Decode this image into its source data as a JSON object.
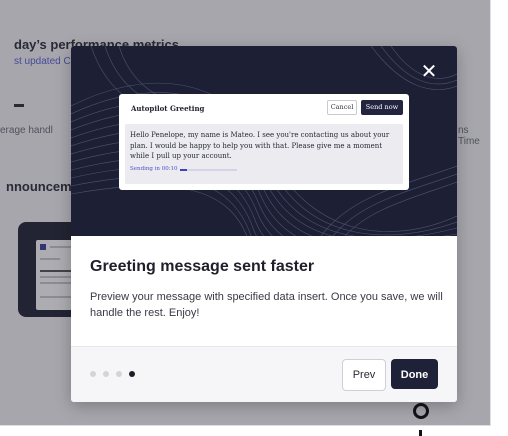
{
  "background": {
    "title": "day’s performance metrics",
    "updated": "st updated C",
    "left_label": "erage handl",
    "right_label": "ns Time",
    "announcements": "nnounceme"
  },
  "modal": {
    "close_icon": "close-icon",
    "preview": {
      "title": "Autopilot Greeting",
      "cancel": "Cancel",
      "send": "Send now",
      "message": "Hello Penelope, my name is Mateo. I see you're contacting us about your plan. I would be happy to help you with that. Please give me a moment while I pull up your account.",
      "sending": "Sending in 00:10",
      "progress": 0.12
    },
    "title": "Greeting message sent faster",
    "description": "Preview your message with specified data insert. Once you save, we will handle the rest. Enjoy!",
    "steps_total": 4,
    "step_active": 4,
    "prev": "Prev",
    "done": "Done"
  },
  "colors": {
    "hero_bg": "#1d2035",
    "primary": "#1f2138",
    "accent": "#4a50c8"
  }
}
